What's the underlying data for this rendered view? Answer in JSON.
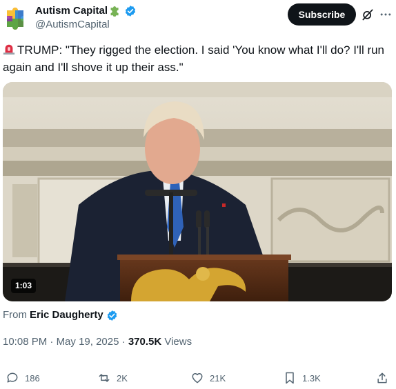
{
  "header": {
    "display_name": "Autism Capital",
    "handle": "@AutismCapital",
    "subscribe_label": "Subscribe",
    "icons": [
      "puzzle-piece-icon",
      "verified-badge-icon",
      "grok-icon",
      "more-icon"
    ]
  },
  "tweet": {
    "emoji": "rotating-light",
    "text": "TRUMP: \"They rigged the election. I said 'You know what I'll do? I'll run again and I'll shove it up their ass.\""
  },
  "video": {
    "duration": "1:03"
  },
  "source": {
    "prefix": "From",
    "author": "Eric Daugherty"
  },
  "meta": {
    "time": "10:08 PM",
    "separator": "·",
    "date": "May 19, 2025",
    "views_count": "370.5K",
    "views_label": "Views"
  },
  "actions": {
    "replies": "186",
    "reposts": "2K",
    "likes": "21K",
    "bookmarks": "1.3K"
  },
  "colors": {
    "text": "#0f1419",
    "secondary": "#536471",
    "verified": "#1d9bf0",
    "button_bg": "#0f1419"
  }
}
